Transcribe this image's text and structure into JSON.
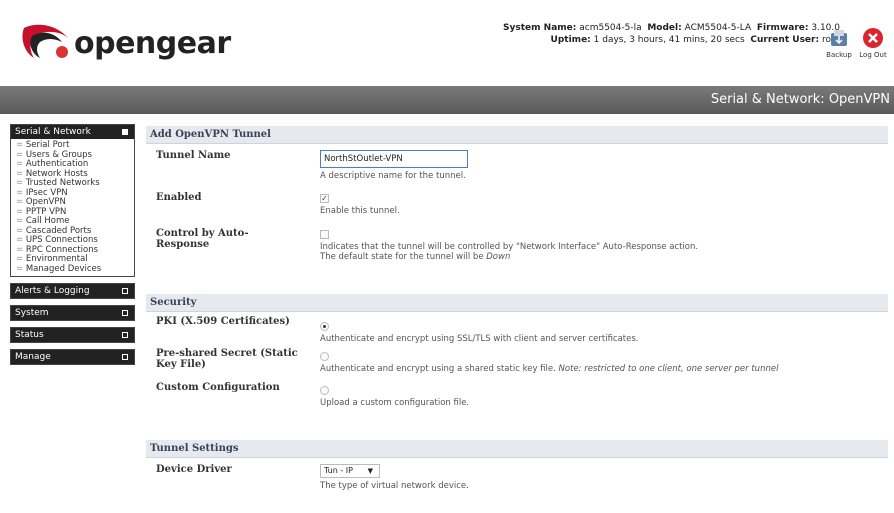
{
  "header": {
    "logo_text": "opengear",
    "system_name_label": "System Name:",
    "system_name": "acm5504-5-la",
    "model_label": "Model:",
    "model": "ACM5504-5-LA",
    "firmware_label": "Firmware:",
    "firmware": "3.10.0",
    "uptime_label": "Uptime:",
    "uptime": "1 days, 3 hours, 41 mins, 20 secs",
    "current_user_label": "Current User:",
    "current_user": "root",
    "backup_label": "Backup",
    "logout_label": "Log Out"
  },
  "page_title": "Serial & Network: OpenVPN",
  "sidebar": {
    "serial_network": {
      "label": "Serial & Network",
      "items": [
        "Serial Port",
        "Users & Groups",
        "Authentication",
        "Network Hosts",
        "Trusted Networks",
        "IPsec VPN",
        "OpenVPN",
        "PPTP VPN",
        "Call Home",
        "Cascaded Ports",
        "UPS Connections",
        "RPC Connections",
        "Environmental",
        "Managed Devices"
      ]
    },
    "alerts": {
      "label": "Alerts & Logging"
    },
    "system": {
      "label": "System"
    },
    "status": {
      "label": "Status"
    },
    "manage": {
      "label": "Manage"
    }
  },
  "add_tunnel": {
    "section": "Add OpenVPN Tunnel",
    "tunnel_name_label": "Tunnel Name",
    "tunnel_name_value": "NorthStOutlet-VPN",
    "tunnel_name_help": "A descriptive name for the tunnel.",
    "enabled_label": "Enabled",
    "enabled_help": "Enable this tunnel.",
    "autoresp_label": "Control by Auto-Response",
    "autoresp_help1": "Indicates that the tunnel will be controlled by \"Network Interface\" Auto-Response action.",
    "autoresp_help2_prefix": "The default state for the tunnel will be ",
    "autoresp_help2_em": "Down"
  },
  "security": {
    "section": "Security",
    "pki_label": "PKI (X.509 Certificates)",
    "pki_help": "Authenticate and encrypt using SSL/TLS with client and server certificates.",
    "psk_label": "Pre-shared Secret (Static Key File)",
    "psk_help": "Authenticate and encrypt using a shared static key file. ",
    "psk_note": "Note: restricted to one client, one server per tunnel",
    "custom_label": "Custom Configuration",
    "custom_help": "Upload a custom configuration file."
  },
  "tunnel_settings": {
    "section": "Tunnel Settings",
    "device_driver_label": "Device Driver",
    "device_driver_value": "Tun - IP",
    "device_driver_help": "The type of virtual network device."
  },
  "colors": {
    "banner": "#666666",
    "accent": "#3a3f5a",
    "logo_red": "#c8102e"
  }
}
